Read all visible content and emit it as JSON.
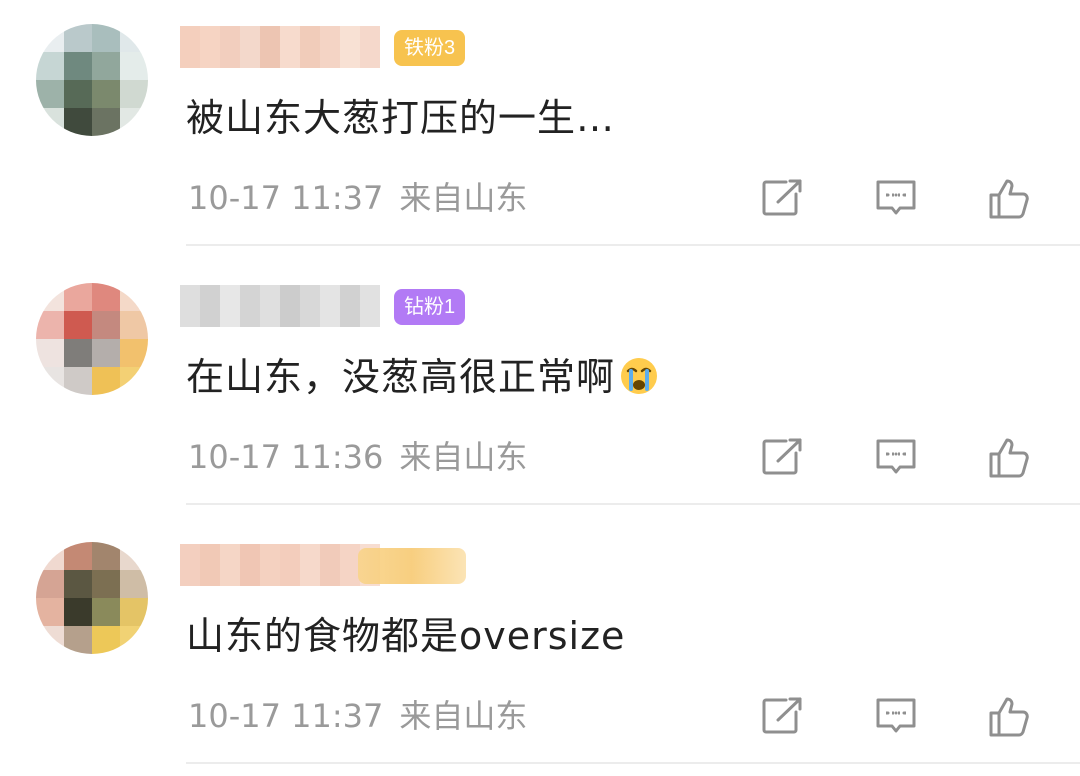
{
  "comments": [
    {
      "badge": "铁粉3",
      "badge_color": "#f7c34f",
      "text": "被山东大葱打压的一生…",
      "emoji": "",
      "time": "10-17 11:37",
      "location": "来自山东",
      "avatar_colors": [
        "#e9eef0",
        "#b9c9cc",
        "#a7bfbd",
        "#dfe8ea",
        "#c5d6d4",
        "#6d8a7f",
        "#8fa89b",
        "#e3ecea",
        "#9bb3a8",
        "#556b55",
        "#7a8a6a",
        "#cfd9d0",
        "#d8e2dd",
        "#3f4a3c",
        "#6a7360",
        "#e2e8e4"
      ],
      "username_colors": [
        "#f3c7b2",
        "#f5cdb9",
        "#f0c6b3",
        "#f2d2c3",
        "#eabba5",
        "#f6d5c5",
        "#efc4ae",
        "#f3cdbb",
        "#f7dccd",
        "#f4d2c2"
      ]
    },
    {
      "badge": "钻粉1",
      "badge_color": "#b27af5",
      "text": "在山东，没葱高很正常啊",
      "emoji": "loudly-crying-face",
      "time": "10-17 11:36",
      "location": "来自山东",
      "avatar_colors": [
        "#f4e3dc",
        "#f0a59a",
        "#e7867b",
        "#f6d9c6",
        "#f1b3aa",
        "#d9574c",
        "#c9887d",
        "#f3c7a0",
        "#efe3df",
        "#7f7d7a",
        "#b5aeaa",
        "#f7c063",
        "#e8e4e2",
        "#cfcac7",
        "#f4c14a",
        "#f7d06a"
      ],
      "username_colors": [
        "#d9d9d9",
        "#c9c9c9",
        "#e3e3e3",
        "#cdcdcd",
        "#dadada",
        "#c4c4c4",
        "#d2d2d2",
        "#e0e0e0",
        "#cacaca",
        "#dcdcdc"
      ]
    },
    {
      "badge": "",
      "badge_color": "#f7c34f",
      "text": "山东的食物都是oversize",
      "emoji": "",
      "time": "10-17 11:37",
      "location": "来自山东",
      "avatar_colors": [
        "#f2d9cf",
        "#c98870",
        "#a5846a",
        "#ead8cc",
        "#d9a391",
        "#5b5740",
        "#7d6f4f",
        "#d1bda3",
        "#e8b29d",
        "#3a3a2a",
        "#8a8a56",
        "#e8c45c",
        "#f0dcd3",
        "#b7a089",
        "#f1c84c",
        "#f4d26a"
      ],
      "username_colors": [
        "#f2c7b4",
        "#efc0aa",
        "#f4cfbd",
        "#eebda7",
        "#f3cab6",
        "#f1c5b1",
        "#f5d3c3",
        "#efc2ae",
        "#f4cdbb",
        "#f6d8ca"
      ]
    }
  ],
  "icons": {
    "repost": "repost-icon",
    "reply": "comment-icon",
    "like": "thumbs-up-icon"
  },
  "colors": {
    "text": "#222222",
    "meta": "#9a9a9a",
    "divider": "#ececec",
    "icon": "#8f8f8f"
  }
}
